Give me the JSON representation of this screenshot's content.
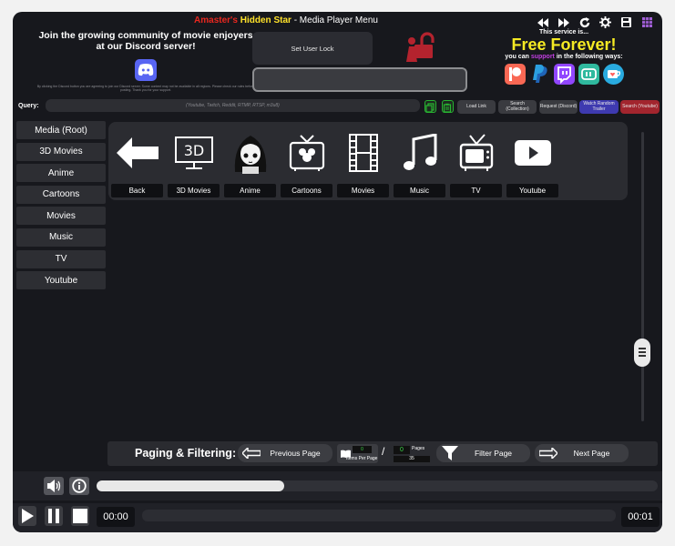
{
  "header": {
    "title_part1": "Amaster's",
    "title_part2": "Hidden Star",
    "title_part3": "- Media Player Menu",
    "window_controls": [
      "rewind-icon",
      "fast-forward-icon",
      "refresh-icon",
      "settings-icon",
      "save-icon",
      "grid-icon"
    ]
  },
  "discord": {
    "text": "Join the growing community of movie enjoyers at our Discord server!",
    "fine_print": "By clicking the Discord button you are agreeing to join our Discord server. Some content may not be available in all regions. Please check our rules before posting. Thank you for your support."
  },
  "user_lock": {
    "button_label": "Set User Lock",
    "field_value": ""
  },
  "support": {
    "service_text": "This service is...",
    "free_text": "Free Forever!",
    "line_pre": "you can",
    "line_highlight": "support",
    "line_post": "in the following ways:",
    "icons": [
      "patreon-icon",
      "paypal-icon",
      "twitch-icon",
      "media-icon",
      "kofi-icon"
    ]
  },
  "query": {
    "label": "Query:",
    "placeholder": "(Youtube, Twitch, Reddit, RTMP, RTSP, m3u8)",
    "buttons": {
      "load_link": "Load Link",
      "search_collection": "Search (Collection)",
      "request_discord": "Request (Discord)",
      "watch_random": "Watch Random Trailer",
      "search_youtube": "Search (Youtube)"
    }
  },
  "sidebar": {
    "items": [
      "Media (Root)",
      "3D Movies",
      "Anime",
      "Cartoons",
      "Movies",
      "Music",
      "TV",
      "Youtube"
    ]
  },
  "categories": [
    {
      "label": "Back",
      "icon": "back-arrow-icon"
    },
    {
      "label": "3D Movies",
      "icon": "3d-monitor-icon"
    },
    {
      "label": "Anime",
      "icon": "anime-girl-icon"
    },
    {
      "label": "Cartoons",
      "icon": "cartoon-tv-icon"
    },
    {
      "label": "Movies",
      "icon": "film-strip-icon"
    },
    {
      "label": "Music",
      "icon": "music-note-icon"
    },
    {
      "label": "TV",
      "icon": "retro-tv-icon"
    },
    {
      "label": "Youtube",
      "icon": "youtube-play-icon"
    }
  ],
  "paging": {
    "label": "Paging & Filtering:",
    "previous_label": "Previous Page",
    "filter_label": "Filter Page",
    "next_label": "Next Page",
    "items_count": "0",
    "items_per_page_label": "Items Per Page",
    "slash": "/",
    "pages_count": "0",
    "pages_label": "Pages",
    "per_page_value": "35"
  },
  "player": {
    "seek_fraction": 0.335,
    "time_current": "00:00",
    "time_total": "00:01"
  },
  "colors": {
    "title_red": "#e8271f",
    "title_yellow": "#ffe22a",
    "free_yellow": "#f5ea23",
    "support_purple": "#c13fe0",
    "discord_blurple": "#5865f2",
    "copy_green": "#28b532"
  }
}
